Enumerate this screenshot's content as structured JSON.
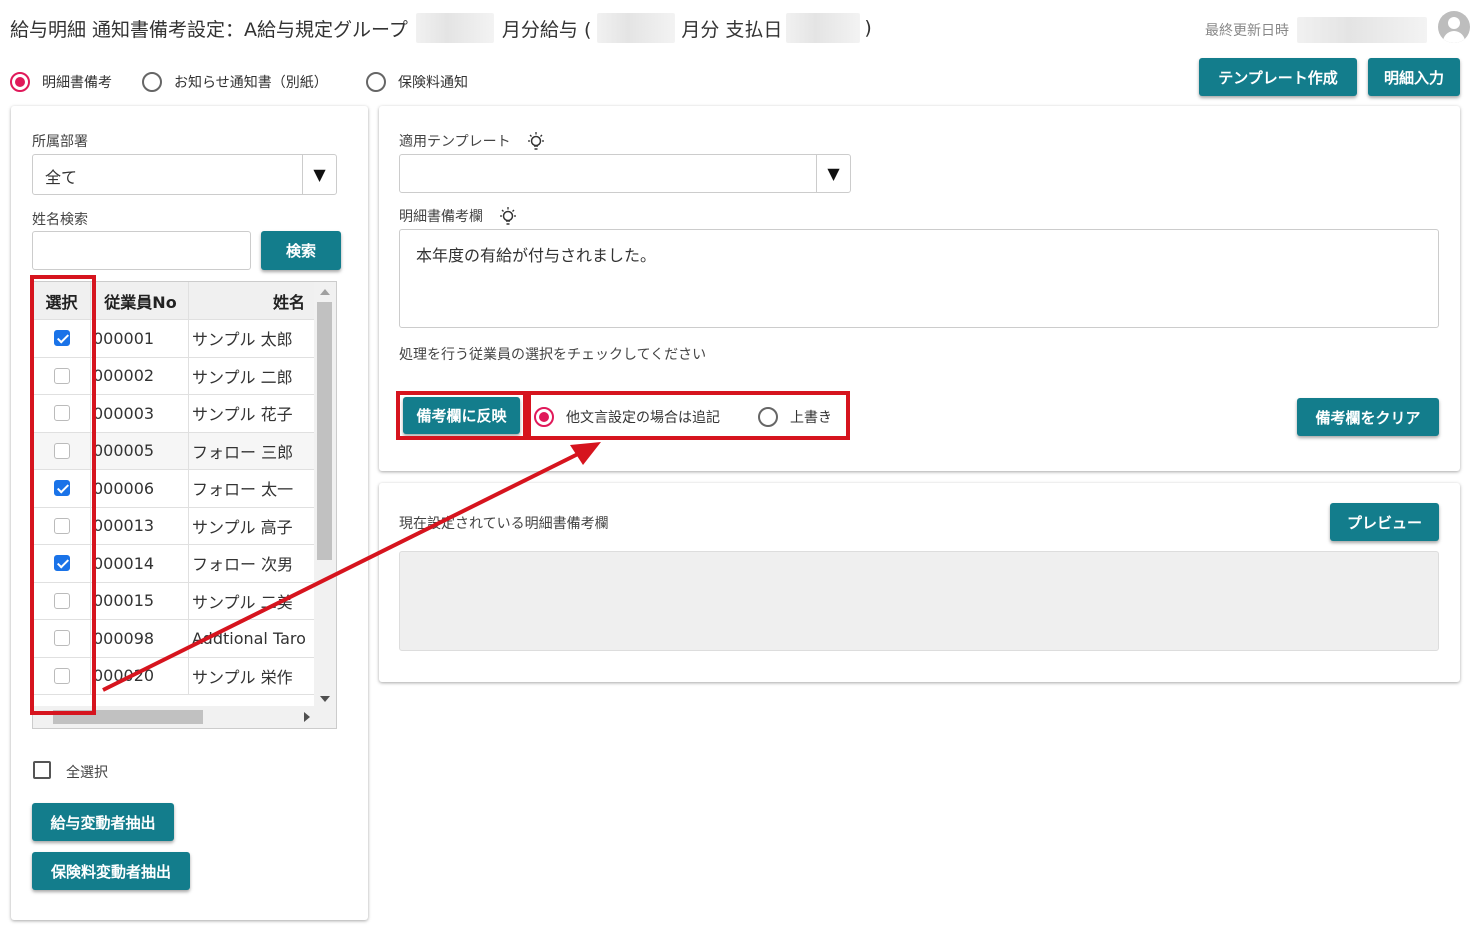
{
  "header": {
    "title_prefix": "給与明細 通知書備考設定：A給与規定グループ",
    "title_month_pay": "月分給与 (",
    "title_month": "月分 支払日",
    "title_close": ")",
    "last_updated_label": "最終更新日時"
  },
  "mode_radios": [
    {
      "label": "明細書備考",
      "selected": true
    },
    {
      "label": "お知らせ通知書（別紙）",
      "selected": false
    },
    {
      "label": "保険料通知",
      "selected": false
    }
  ],
  "top_buttons": {
    "template_create": "テンプレート作成",
    "detail_input": "明細入力"
  },
  "left_panel": {
    "department_label": "所属部署",
    "department_value": "全て",
    "name_search_label": "姓名検索",
    "name_search_value": "",
    "search_button": "検索",
    "table_headers": {
      "select": "選択",
      "emp_no": "従業員No",
      "name": "姓名"
    },
    "rows": [
      {
        "checked": true,
        "emp_no": "000001",
        "name": "サンプル 太郎"
      },
      {
        "checked": false,
        "emp_no": "000002",
        "name": "サンプル 二郎"
      },
      {
        "checked": false,
        "emp_no": "000003",
        "name": "サンプル 花子"
      },
      {
        "checked": false,
        "emp_no": "000005",
        "name": "フォロー 三郎"
      },
      {
        "checked": true,
        "emp_no": "000006",
        "name": "フォロー 太一"
      },
      {
        "checked": false,
        "emp_no": "000013",
        "name": "サンプル 高子"
      },
      {
        "checked": true,
        "emp_no": "000014",
        "name": "フォロー 次男"
      },
      {
        "checked": false,
        "emp_no": "000015",
        "name": "サンプル 二美"
      },
      {
        "checked": false,
        "emp_no": "000098",
        "name": "Addtional Taro"
      },
      {
        "checked": false,
        "emp_no": "000020",
        "name": "サンプル 栄作"
      }
    ],
    "select_all_label": "全選択",
    "salary_change_button": "給与変動者抽出",
    "insurance_change_button": "保険料変動者抽出"
  },
  "right_panel": {
    "template_label": "適用テンプレート",
    "template_value": "",
    "remarks_label": "明細書備考欄",
    "remarks_value": "本年度の有給が付与されました。",
    "instruction": "処理を行う従業員の選択をチェックしてください",
    "apply_button": "備考欄に反映",
    "write_mode_radios": [
      {
        "label": "他文言設定の場合は追記",
        "selected": true
      },
      {
        "label": "上書き",
        "selected": false
      }
    ],
    "clear_button": "備考欄をクリア"
  },
  "current_panel": {
    "label": "現在設定されている明細書備考欄",
    "preview_button": "プレビュー",
    "current_value": ""
  },
  "colors": {
    "accent": "#137d8c",
    "radio_selected": "#e0195a",
    "checkbox_checked": "#1a73e8",
    "annotation_red": "#d6141e"
  }
}
